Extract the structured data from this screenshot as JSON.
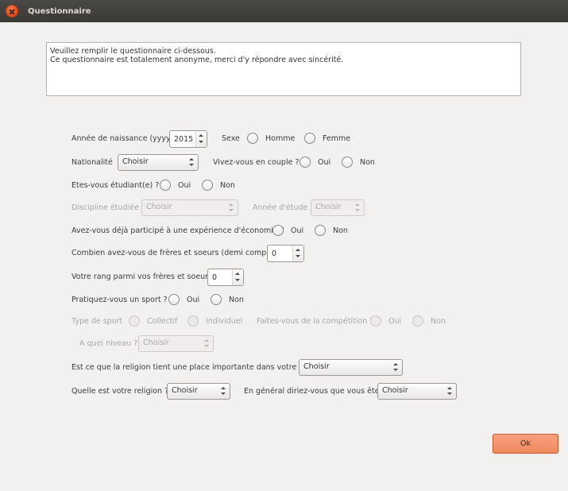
{
  "window": {
    "title": "Questionnaire"
  },
  "intro": {
    "line1": "Veuillez remplir le questionnaire ci-dessous.",
    "line2": "Ce questionnaire est totalement anonyme, merci d'y répondre avec sincérité."
  },
  "birth_year": {
    "label": "Année de naissance (yyyy)",
    "value": "2015"
  },
  "sex": {
    "label": "Sexe",
    "option1": "Homme",
    "option2": "Femme"
  },
  "nationality": {
    "label": "Nationalité",
    "value": "Choisir"
  },
  "couple": {
    "label": "Vivez-vous en couple ?",
    "yes": "Oui",
    "no": "Non"
  },
  "student": {
    "label": "Etes-vous étudiant(e) ?",
    "yes": "Oui",
    "no": "Non"
  },
  "discipline": {
    "label": "Discipline étudiée",
    "value": "Choisir"
  },
  "study_year": {
    "label": "Année d'étude",
    "value": "Choisir"
  },
  "experiment": {
    "label": "Avez-vous déjà participé à une expérience d'économie ?",
    "yes": "Oui",
    "no": "Non"
  },
  "siblings": {
    "label": "Combien avez-vous de frères et soeurs (demi compris)?",
    "value": "0"
  },
  "rank": {
    "label": "Votre rang parmi vos frères et soeurs",
    "value": "0"
  },
  "sport": {
    "label": "Pratiquez-vous un sport ?",
    "yes": "Oui",
    "no": "Non"
  },
  "sport_type": {
    "label": "Type de sport",
    "option1": "Collectif",
    "option2": "Individuel"
  },
  "competition": {
    "label": "Faites-vous de la compétition ?",
    "yes": "Oui",
    "no": "Non"
  },
  "level": {
    "label": "A quel niveau ?",
    "value": "Choisir"
  },
  "religion_importance": {
    "label": "Est ce que la religion tient une place importante dans votre vie ?",
    "value": "Choisir"
  },
  "religion": {
    "label": "Quelle est votre religion ?",
    "value": "Choisir"
  },
  "general": {
    "label": "En général diriez-vous que vous êtes",
    "value": "Choisir"
  },
  "ok_button": {
    "label": "Ok"
  },
  "colors": {
    "accent": "#f08a60",
    "titlebar": "#3c3b37",
    "background": "#f2f1f0"
  }
}
